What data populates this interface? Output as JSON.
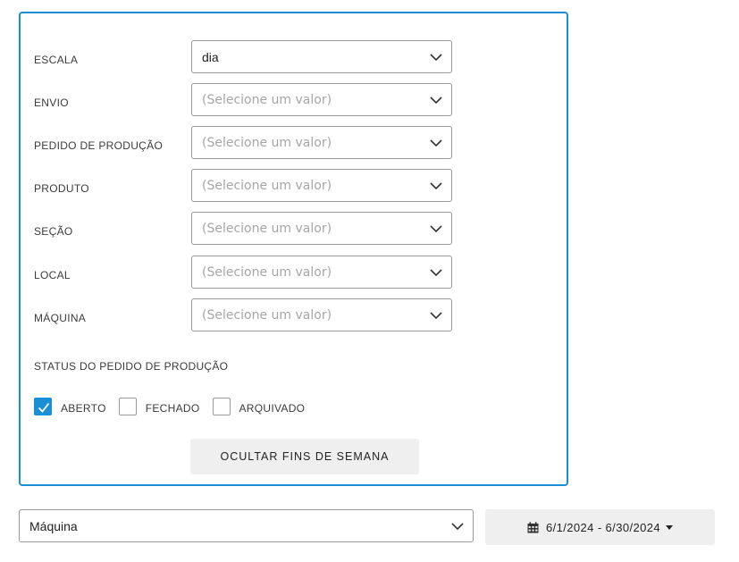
{
  "filters": {
    "rows": [
      {
        "label": "ESCALA",
        "value": "dia",
        "placeholder": false
      },
      {
        "label": "ENVIO",
        "value": "(Selecione um valor)",
        "placeholder": true
      },
      {
        "label": "PEDIDO DE PRODUÇÃO",
        "value": "(Selecione um valor)",
        "placeholder": true
      },
      {
        "label": "PRODUTO",
        "value": "(Selecione um valor)",
        "placeholder": true
      },
      {
        "label": "SEÇÃO",
        "value": "(Selecione um valor)",
        "placeholder": true
      },
      {
        "label": "LOCAL",
        "value": "(Selecione um valor)",
        "placeholder": true
      },
      {
        "label": "MÁQUINA",
        "value": "(Selecione um valor)",
        "placeholder": true
      }
    ],
    "status_title": "STATUS DO PEDIDO DE PRODUÇÃO",
    "status_options": [
      {
        "label": "ABERTO",
        "checked": true
      },
      {
        "label": "FECHADO",
        "checked": false
      },
      {
        "label": "ARQUIVADO",
        "checked": false
      }
    ],
    "hide_weekends_label": "OCULTAR FINS DE SEMANA"
  },
  "grouping": {
    "value": "Máquina"
  },
  "date_range": {
    "label": "6/1/2024 - 6/30/2024",
    "icon": "calendar-icon"
  },
  "colors": {
    "accent": "#1a8fd6",
    "button_bg": "#efefef"
  }
}
